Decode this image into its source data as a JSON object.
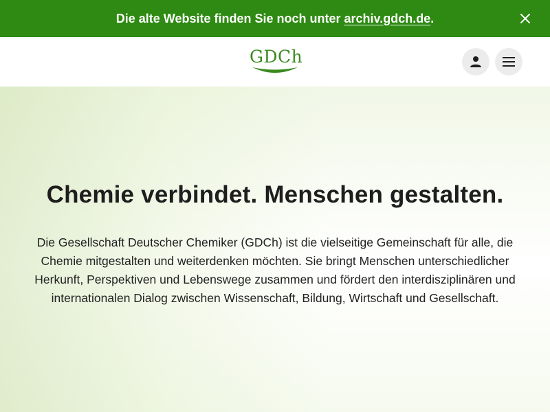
{
  "banner": {
    "text_before": "Die alte Website finden Sie noch unter ",
    "link_text": "archiv.gdch.de",
    "text_after": ".",
    "close_icon": "close-icon"
  },
  "header": {
    "logo_text": "GDCh",
    "user_icon": "user-icon",
    "menu_icon": "hamburger-menu-icon"
  },
  "hero": {
    "title": "Chemie verbindet. Menschen gestalten.",
    "description": "Die Gesellschaft Deutscher Chemiker (GDCh) ist die vielseitige Gemeinschaft für alle, die Chemie mitgestalten und weiterdenken möchten. Sie bringt Menschen unterschiedlicher Herkunft, Perspektiven und Lebenswege zusammen und fördert den interdisziplinären und internationalen Dialog zwischen Wissenschaft, Bildung, Wirtschaft und Gesellschaft."
  },
  "colors": {
    "brand_green": "#2e8a12",
    "logo_green": "#3a8a1e",
    "button_bg": "#ececec"
  }
}
